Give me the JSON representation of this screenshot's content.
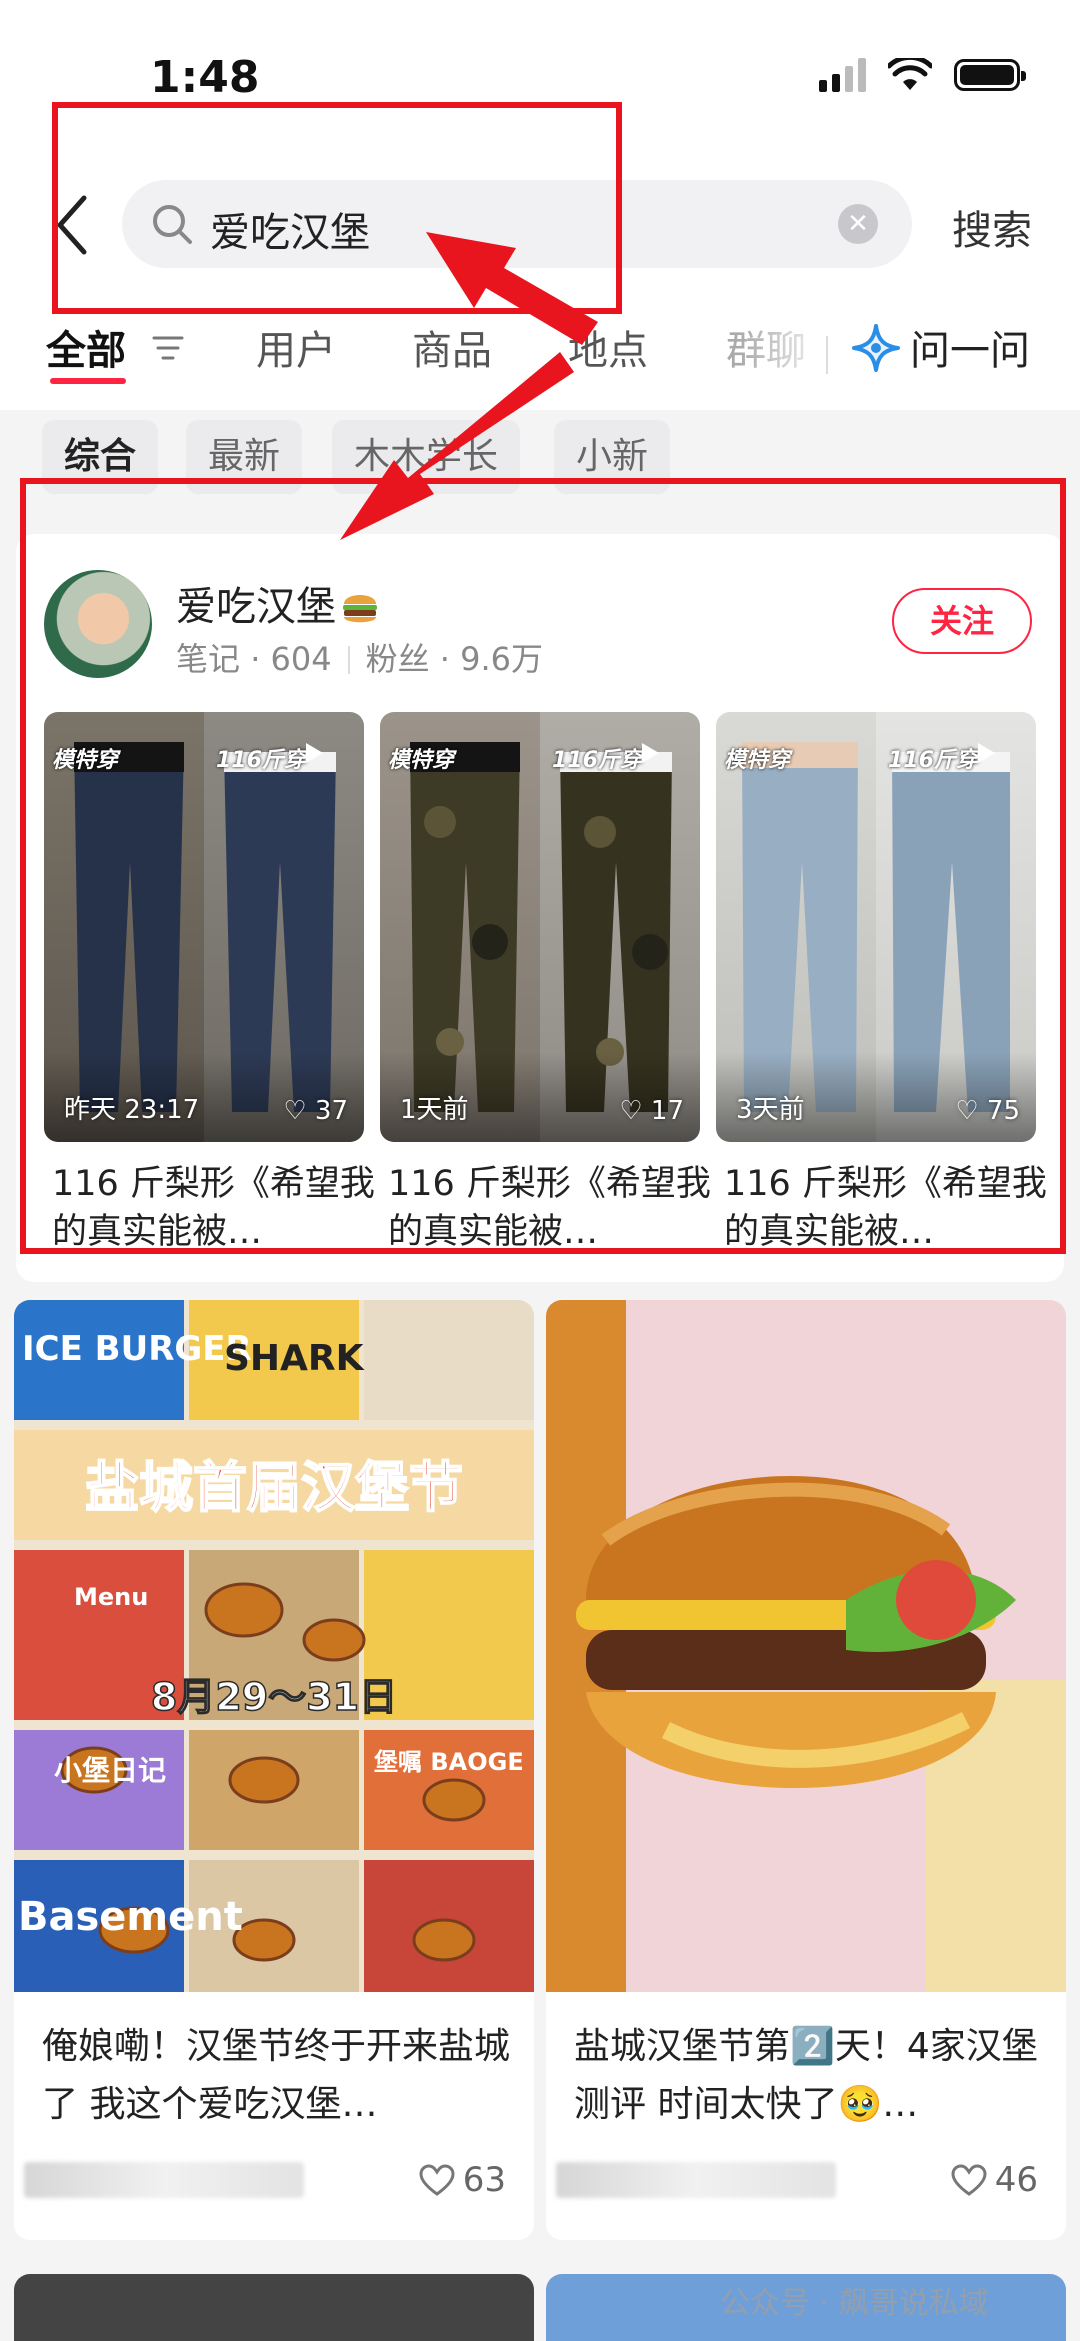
{
  "status_bar": {
    "time": "1:48"
  },
  "search": {
    "query": "爱吃汉堡",
    "submit_label": "搜索"
  },
  "tabs": [
    "全部",
    "用户",
    "商品",
    "地点",
    "群聊"
  ],
  "ask_label": "问一问",
  "chips": [
    "综合",
    "最新",
    "木木学长",
    "小新"
  ],
  "user": {
    "name": "爱吃汉堡",
    "notes_label": "笔记",
    "notes_count": "604",
    "fans_label": "粉丝",
    "fans_count": "9.6万",
    "follow_label": "关注"
  },
  "user_videos": [
    {
      "tag_left": "模特穿",
      "tag_right": "116斤穿",
      "time": "昨天 23:17",
      "likes": "37",
      "title": "116 斤梨形《希望我的真实能被…",
      "color": "#26324a"
    },
    {
      "tag_left": "模特穿",
      "tag_right": "116斤穿",
      "time": "1天前",
      "likes": "17",
      "title": "116 斤梨形《希望我的真实能被…",
      "color": "#3d3a26"
    },
    {
      "tag_left": "模特穿",
      "tag_right": "116斤穿",
      "time": "3天前",
      "likes": "75",
      "title": "116 斤梨形《希望我的真实能被…",
      "color": "#98aec2"
    }
  ],
  "notes": [
    {
      "title": "俺娘嘞！汉堡节终于开来盐城了 我这个爱吃汉堡…",
      "likes": "63",
      "poster_title": "盐城首届汉堡节",
      "poster_date": "8月29～31日",
      "poster_words": [
        "ICE BURGER",
        "SHARK",
        "Menu",
        "小堡日记",
        "Basement",
        "堡嘱 BAOGE"
      ]
    },
    {
      "title": "盐城汉堡节第2️⃣天！4家汉堡测评 时间太快了🥹…",
      "likes": "46"
    }
  ],
  "watermark": "公众号 · 飙哥说私域"
}
